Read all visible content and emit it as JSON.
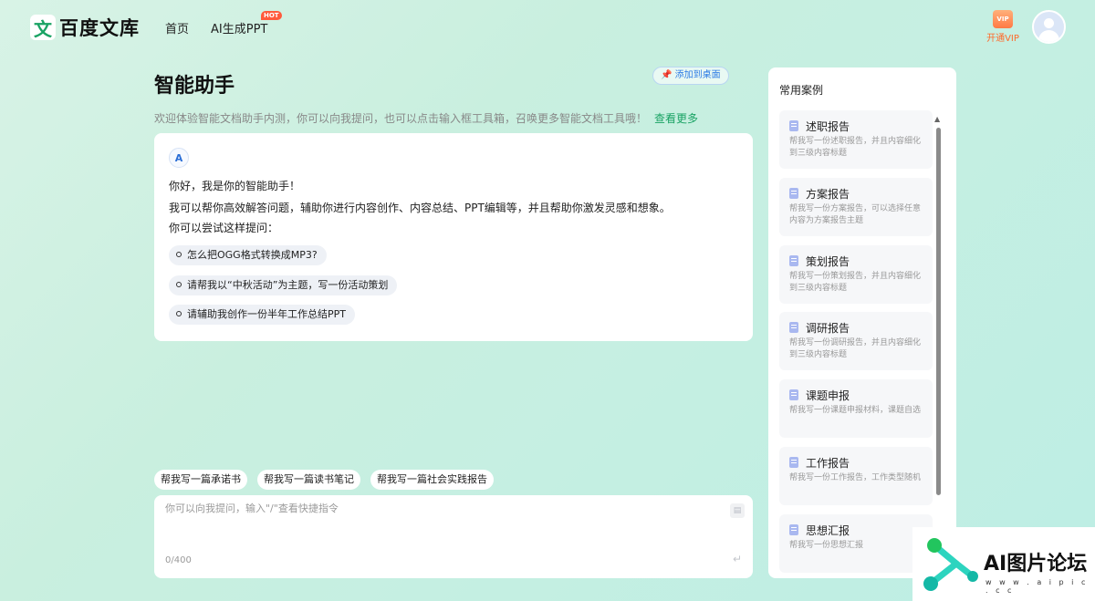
{
  "header": {
    "logo_char": "文",
    "logo_text": "百度文库",
    "nav": {
      "home": "首页",
      "ai_ppt": "AI生成PPT",
      "hot": "HOT"
    },
    "vip_icon": "VIP",
    "vip_label": "开通VIP"
  },
  "main": {
    "title": "智能助手",
    "add_desktop": "📌 添加到桌面",
    "intro": "欢迎体验智能文档助手内测，你可以向我提问，也可以点击输入框工具箱，召唤更多智能文档工具哦！",
    "more": "查看更多"
  },
  "chat": {
    "bot_badge": "A",
    "greeting": "你好，我是你的智能助手！",
    "ability": "我可以帮你高效解答问题，辅助你进行内容创作、内容总结、PPT编辑等，并且帮助你激发灵感和想象。",
    "try_hint": "你可以尝试这样提问：",
    "suggestions": [
      "怎么把OGG格式转换成MP3?",
      "请帮我以“中秋活动”为主题，写一份活动策划",
      "请辅助我创作一份半年工作总结PPT"
    ]
  },
  "chips": [
    "帮我写一篇承诺书",
    "帮我写一篇读书笔记",
    "帮我写一篇社会实践报告"
  ],
  "input": {
    "placeholder": "你可以向我提问，输入\"/\"查看快捷指令",
    "value": "",
    "counter": "0/400"
  },
  "side": {
    "title": "常用案例",
    "cases": [
      {
        "name": "述职报告",
        "desc": "帮我写一份述职报告，并且内容细化到三级内容标题"
      },
      {
        "name": "方案报告",
        "desc": "帮我写一份方案报告，可以选择任意内容为方案报告主题"
      },
      {
        "name": "策划报告",
        "desc": "帮我写一份策划报告，并且内容细化到三级内容标题"
      },
      {
        "name": "调研报告",
        "desc": "帮我写一份调研报告，并且内容细化到三级内容标题"
      },
      {
        "name": "课题申报",
        "desc": "帮我写一份课题申报材料，课题自选"
      },
      {
        "name": "工作报告",
        "desc": "帮我写一份工作报告，工作类型随机"
      },
      {
        "name": "思想汇报",
        "desc": "帮我写一份思想汇报"
      }
    ]
  },
  "watermark": {
    "text": "AI图片论坛",
    "url": "w w w . a i p i c . c c"
  },
  "colors": {
    "brand_green": "#1aa364",
    "vip_orange": "#ff6a2a",
    "hot_red": "#ff5a3c",
    "link_blue": "#2c7be5"
  }
}
